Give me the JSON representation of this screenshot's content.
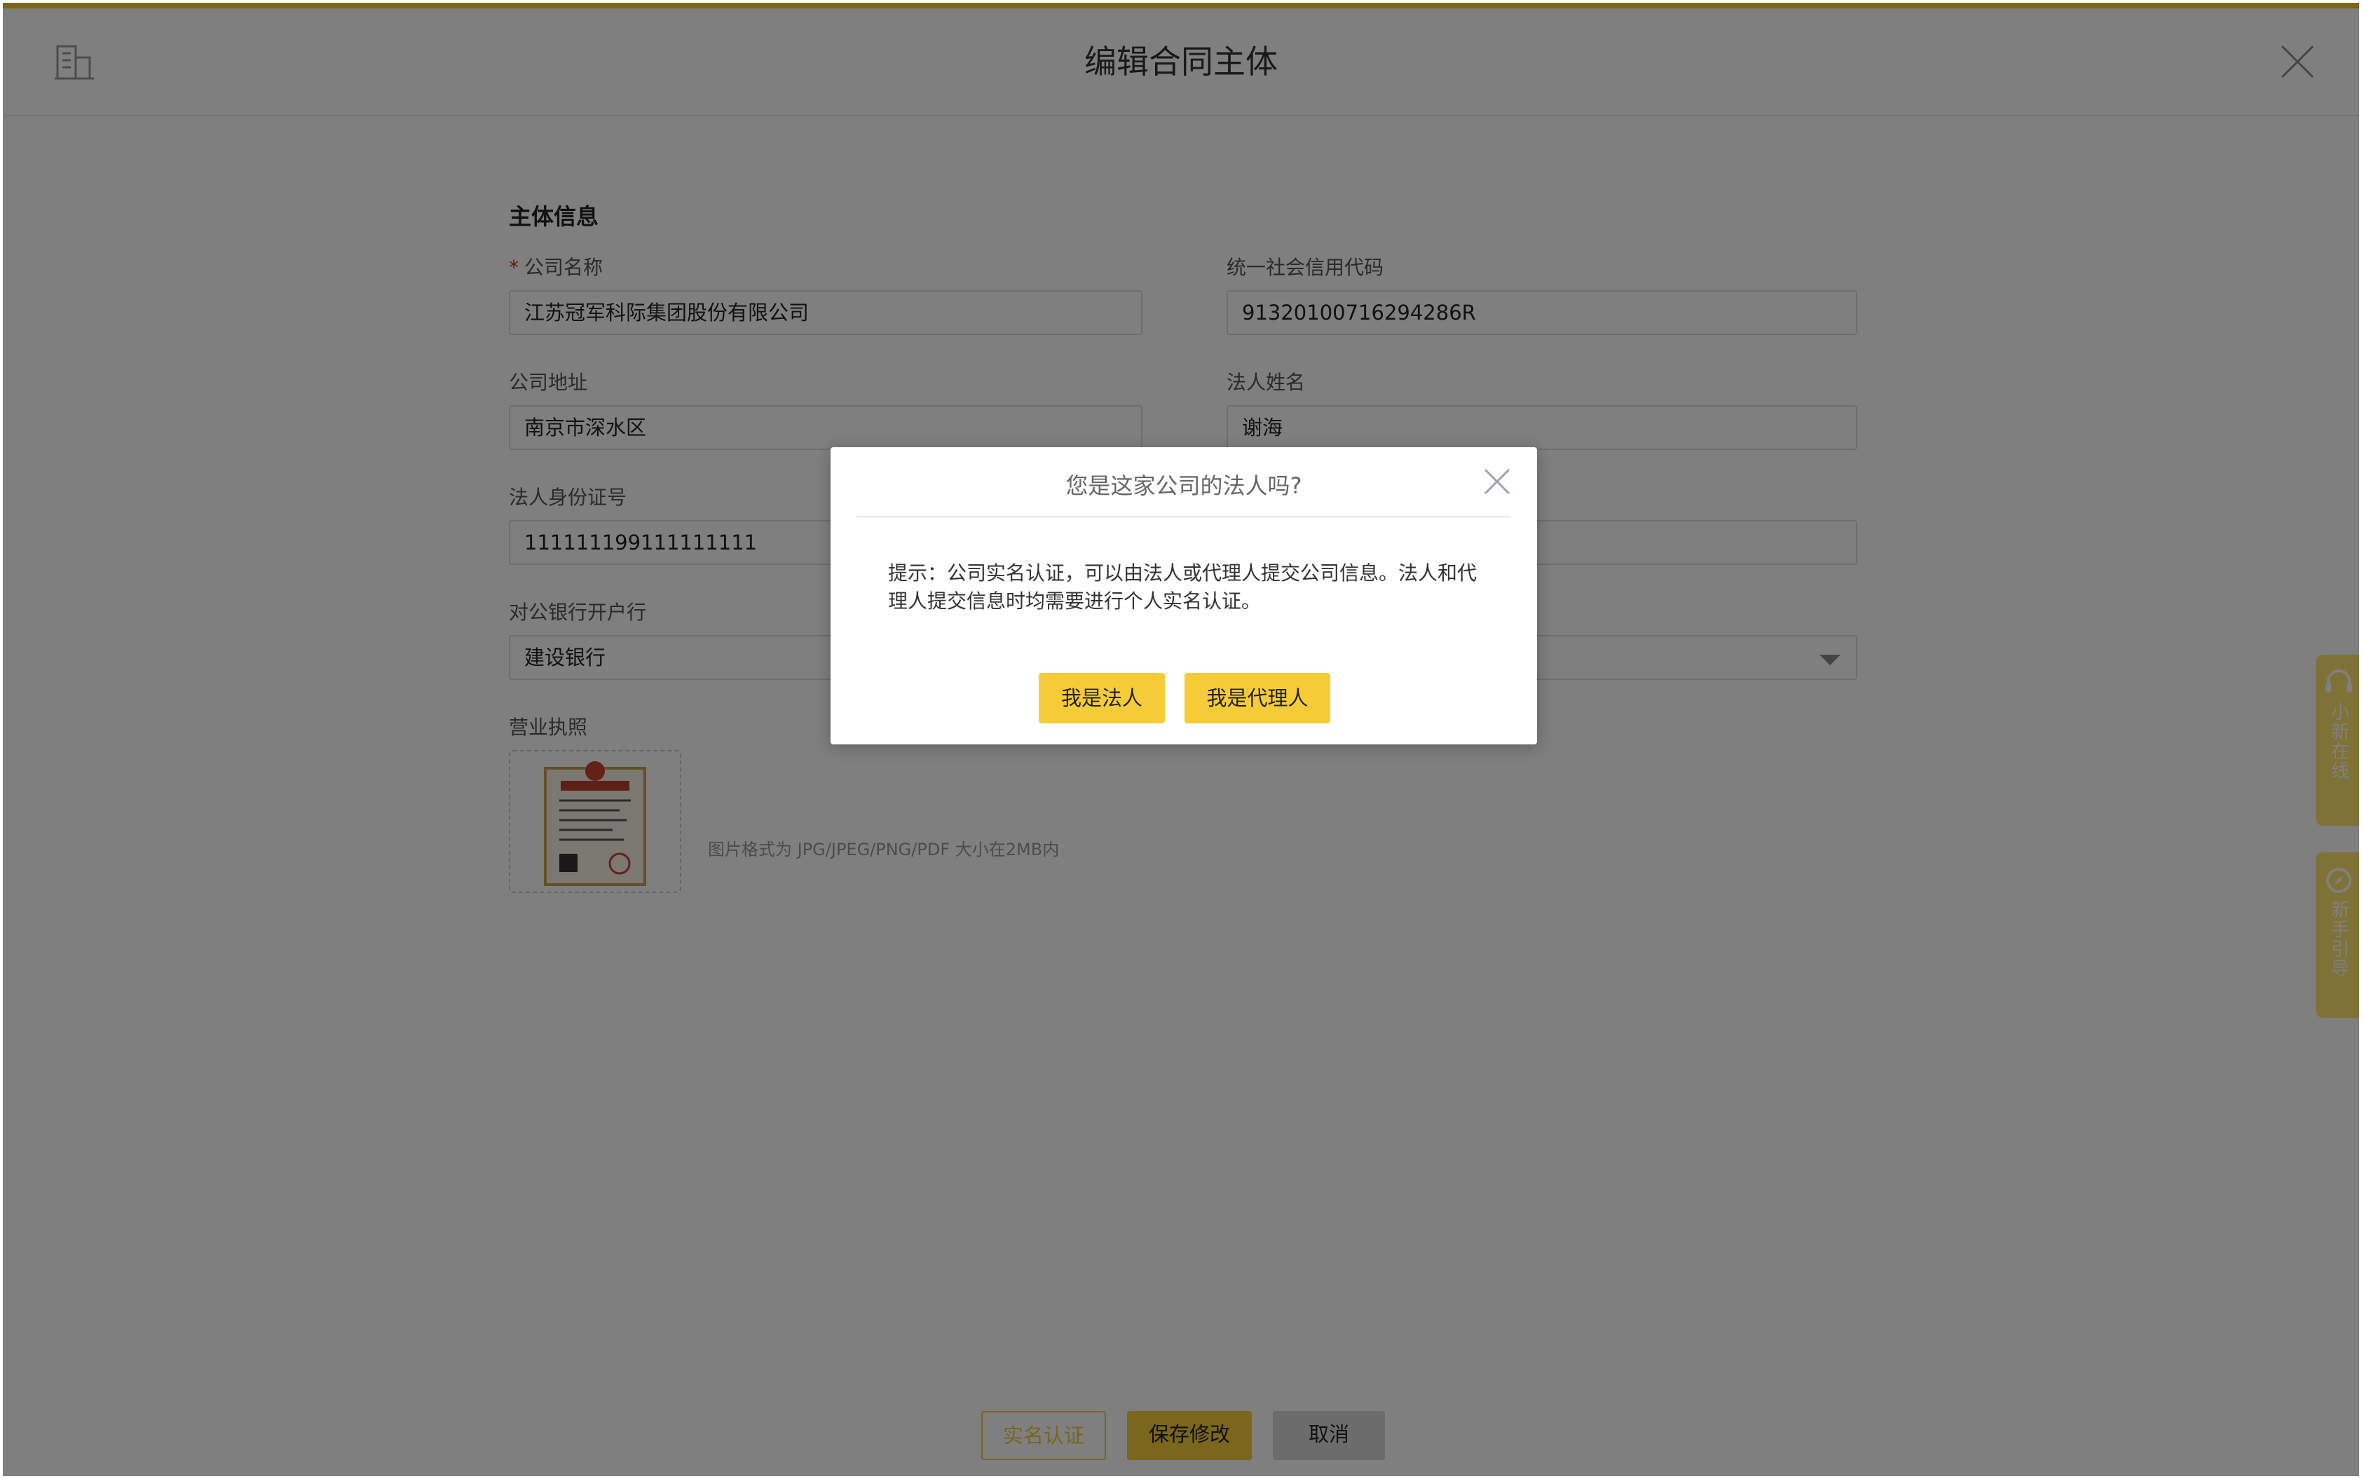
{
  "header": {
    "title": "编辑合同主体"
  },
  "form": {
    "section_title": "主体信息",
    "required_mark": "*",
    "company_name_label": "公司名称",
    "company_name_value": "江苏冠军科际集团股份有限公司",
    "credit_code_label": "统一社会信用代码",
    "credit_code_value": "91320100716294286R",
    "address_label": "公司地址",
    "address_value": "南京市深水区",
    "legal_name_label": "法人姓名",
    "legal_name_value": "谢海",
    "legal_id_label": "法人身份证号",
    "legal_id_value": "111111199111111111",
    "bank_label": "对公银行开户行",
    "bank_value": "建设银行",
    "license_label": "营业执照",
    "license_hint": "图片格式为 JPG/JPEG/PNG/PDF 大小在2MB内"
  },
  "footer": {
    "verify_label": "实名认证",
    "save_label": "保存修改",
    "cancel_label": "取消"
  },
  "side_tabs": {
    "online_label": "小新在线",
    "guide_label": "新手引导"
  },
  "modal": {
    "title": "您是这家公司的法人吗?",
    "body": "提示：公司实名认证，可以由法人或代理人提交公司信息。法人和代理人提交信息时均需要进行个人实名认证。",
    "legal_button": "我是法人",
    "agent_button": "我是代理人"
  },
  "colors": {
    "accent": "#F5CC38",
    "side_tab": "#FFE56E",
    "required": "#d9331e",
    "overlay": "rgba(0,0,0,0.5)"
  },
  "icons": [
    "building-icon",
    "close-icon",
    "chevron-down-icon",
    "headset-icon",
    "compass-icon",
    "license-thumbnail"
  ]
}
